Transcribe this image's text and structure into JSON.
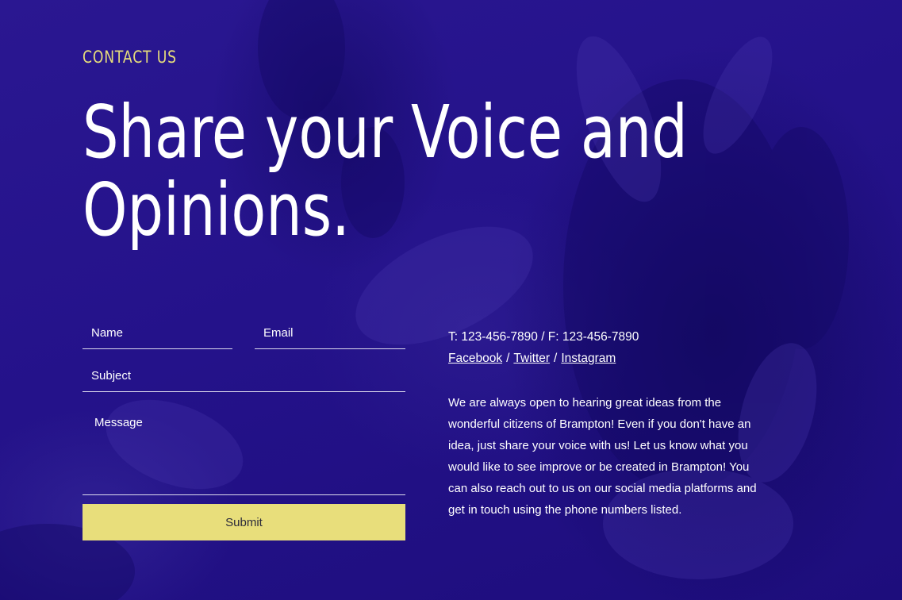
{
  "section_label": "CONTACT US",
  "headline": {
    "line1": "Share your Voice and",
    "line2": "Opinions."
  },
  "form": {
    "name_placeholder": "Name",
    "email_placeholder": "Email",
    "subject_placeholder": "Subject",
    "message_placeholder": "Message",
    "submit_label": "Submit"
  },
  "contact": {
    "phones": "T: 123-456-7890 / F: 123-456-7890",
    "social": {
      "facebook": "Facebook",
      "twitter": "Twitter",
      "instagram": "Instagram",
      "separator": "/"
    }
  },
  "about_text": "We are always open to hearing great ideas from the wonderful citizens of Brampton! Even if you don't have an idea, just share your voice with us! Let us know what you would like to see improve or be created in Brampton! You can also reach out to us on our social media platforms and get in touch using the phone numbers listed.",
  "colors": {
    "background": "#24128a",
    "accent_yellow": "#e8de7b",
    "text": "#ffffff"
  },
  "background_image": "purple-tinted-flower-photo"
}
